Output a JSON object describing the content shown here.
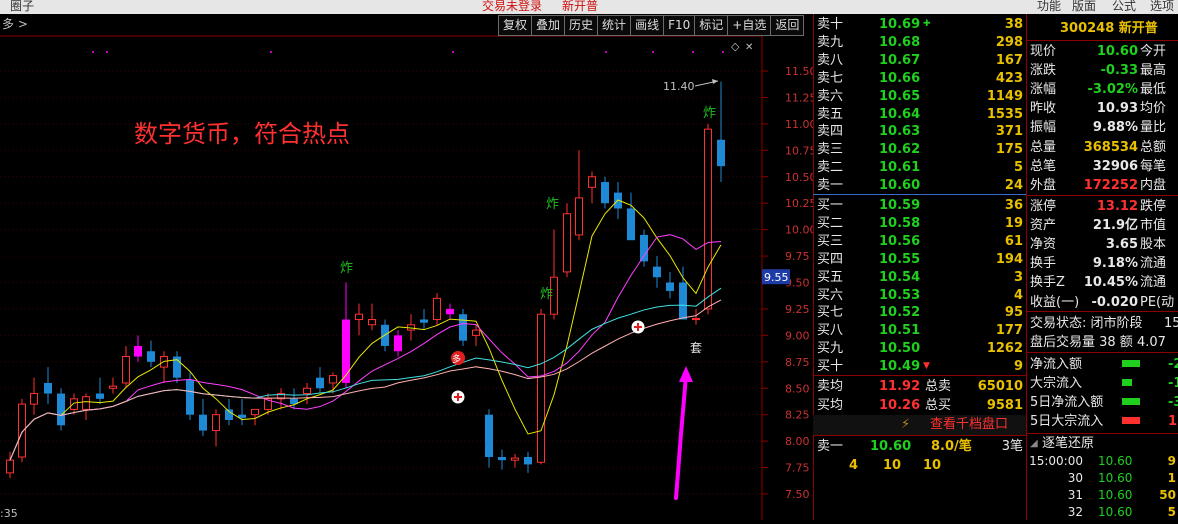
{
  "menubar": {
    "left_item": "圈子",
    "center_notice": "交易未登录",
    "stock_name_top": "新开普",
    "right_items": [
      "功能",
      "版面",
      "公式",
      "选项"
    ]
  },
  "toolbar": {
    "buttons": [
      "复权",
      "叠加",
      "历史",
      "统计",
      "画线",
      "F10",
      "标记",
      "+自选",
      "返回"
    ]
  },
  "chart": {
    "annotation_text": "数字货币，符合热点",
    "annotation_color": "#ff3030",
    "top_left_label": "多 >",
    "bottom_left_label": ":35",
    "max_price_label": "11.40",
    "current_price_tag": "9.55",
    "price_ticks": [
      "11.50",
      "11.25",
      "11.00",
      "10.75",
      "10.50",
      "10.25",
      "10.00",
      "9.75",
      "9.50",
      "9.25",
      "9.00",
      "8.75",
      "8.50",
      "8.25",
      "8.00",
      "7.75",
      "7.50"
    ],
    "zha_marks": [
      "炸",
      "炸",
      "炸",
      "炸"
    ],
    "duo_mark": "多",
    "tao_mark": "套",
    "up_color": "#ff3030",
    "down_color": "#1e8ad6",
    "magenta_color": "#ff00ff"
  },
  "order_book": {
    "asks": [
      {
        "label": "卖十",
        "price": "10.69",
        "vol": "38",
        "marker": "✚"
      },
      {
        "label": "卖九",
        "price": "10.68",
        "vol": "298"
      },
      {
        "label": "卖八",
        "price": "10.67",
        "vol": "167"
      },
      {
        "label": "卖七",
        "price": "10.66",
        "vol": "423"
      },
      {
        "label": "卖六",
        "price": "10.65",
        "vol": "1149"
      },
      {
        "label": "卖五",
        "price": "10.64",
        "vol": "1535"
      },
      {
        "label": "卖四",
        "price": "10.63",
        "vol": "371"
      },
      {
        "label": "卖三",
        "price": "10.62",
        "vol": "175"
      },
      {
        "label": "卖二",
        "price": "10.61",
        "vol": "5"
      },
      {
        "label": "卖一",
        "price": "10.60",
        "vol": "24"
      }
    ],
    "bids": [
      {
        "label": "买一",
        "price": "10.59",
        "vol": "36"
      },
      {
        "label": "买二",
        "price": "10.58",
        "vol": "19"
      },
      {
        "label": "买三",
        "price": "10.56",
        "vol": "61"
      },
      {
        "label": "买四",
        "price": "10.55",
        "vol": "194"
      },
      {
        "label": "买五",
        "price": "10.54",
        "vol": "3"
      },
      {
        "label": "买六",
        "price": "10.53",
        "vol": "4"
      },
      {
        "label": "买七",
        "price": "10.52",
        "vol": "95"
      },
      {
        "label": "买八",
        "price": "10.51",
        "vol": "177"
      },
      {
        "label": "买九",
        "price": "10.50",
        "vol": "1262"
      },
      {
        "label": "买十",
        "price": "10.49",
        "vol": "9",
        "marker": "▼"
      }
    ],
    "avg_ask": {
      "label": "卖均",
      "price": "11.92",
      "total_label": "总卖",
      "total": "65010"
    },
    "avg_bid": {
      "label": "买均",
      "price": "10.26",
      "total_label": "总买",
      "total": "9581"
    },
    "view_button": "查看千档盘口",
    "lightning_icon": "⚡",
    "tick_row": {
      "label": "卖一",
      "price": "10.60",
      "per": "8.0/笔",
      "count": "3笔"
    },
    "queue": [
      "4",
      "10",
      "10"
    ]
  },
  "info": {
    "code_name": "300248 新开普",
    "rows": [
      {
        "label": "现价",
        "value": "10.60",
        "color": "green",
        "right": "今开"
      },
      {
        "label": "涨跌",
        "value": "-0.33",
        "color": "green",
        "right": "最高"
      },
      {
        "label": "涨幅",
        "value": "-3.02%",
        "color": "green",
        "right": "最低"
      },
      {
        "label": "昨收",
        "value": "10.93",
        "color": "white",
        "right": "均价"
      },
      {
        "label": "振幅",
        "value": "9.88%",
        "color": "white",
        "right": "量比"
      },
      {
        "label": "总量",
        "value": "368534",
        "color": "yellow",
        "right": "总额"
      },
      {
        "label": "总笔",
        "value": "32906",
        "color": "white",
        "right": "每笔"
      },
      {
        "label": "外盘",
        "value": "172252",
        "color": "red",
        "right": "内盘"
      }
    ],
    "rows2": [
      {
        "label": "涨停",
        "value": "13.12",
        "color": "red",
        "right": "跌停"
      },
      {
        "label": "资产",
        "value": "21.9亿",
        "color": "white",
        "right": "市值"
      },
      {
        "label": "净资",
        "value": "3.65",
        "color": "white",
        "right": "股本"
      },
      {
        "label": "换手",
        "value": "9.18%",
        "color": "white",
        "right": "流通"
      },
      {
        "label": "换手Z",
        "value": "10.45%",
        "color": "white",
        "right": "流通"
      },
      {
        "label": "收益(一)",
        "value": "-0.020",
        "color": "white",
        "right": "PE(动"
      }
    ],
    "trade_status": "交易状态: 闭市阶段",
    "trade_status_tail": "15",
    "after_hours": "盘后交易量 38 额 4.07",
    "flows": [
      {
        "label": "净流入额",
        "value": "-2",
        "bar_color": "#1fd01f"
      },
      {
        "label": "大宗流入",
        "value": "-1",
        "bar_color": "#1fd01f"
      },
      {
        "label": "5日净流入额",
        "value": "-3",
        "bar_color": "#1fd01f"
      },
      {
        "label": "5日大宗流入",
        "value": "1",
        "bar_color": "#ff3030"
      }
    ],
    "tick_header": "逐笔还原",
    "ticks": [
      {
        "time": "15:00:00",
        "price": "10.60",
        "vol": "9"
      },
      {
        "time": "30",
        "price": "10.60",
        "vol": "1"
      },
      {
        "time": "31",
        "price": "10.60",
        "vol": "50"
      },
      {
        "time": "32",
        "price": "10.60",
        "vol": "5"
      }
    ]
  }
}
